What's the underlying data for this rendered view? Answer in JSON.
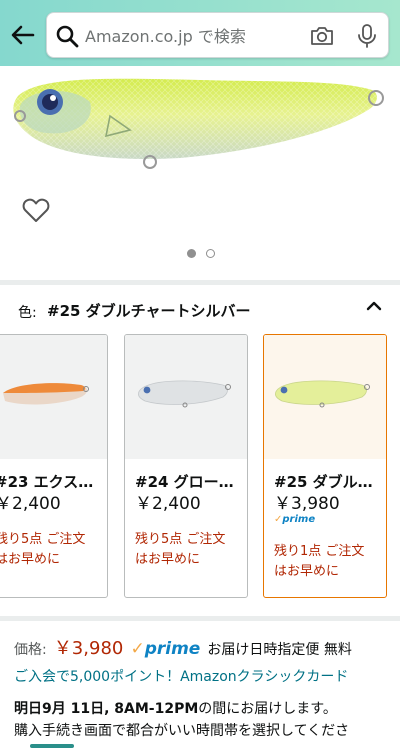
{
  "search": {
    "placeholder": "Amazon.co.jp で検索",
    "icons": [
      "back-arrow-icon",
      "search-icon",
      "camera-icon",
      "microphone-icon"
    ]
  },
  "gallery": {
    "current_image": 1,
    "total_images": 2
  },
  "color_selector": {
    "label": "色:",
    "selected": "#25 ダブルチャートシルバー",
    "options": [
      {
        "name": "#23 エクス…",
        "price": "￥2,400",
        "prime": "",
        "stock_line1": "残り5点 ご注文",
        "stock_line2": "はお早めに"
      },
      {
        "name": "#24 グロー…",
        "price": "￥2,400",
        "prime": "",
        "stock_line1": "残り5点 ご注文",
        "stock_line2": "はお早めに"
      },
      {
        "name": "#25 ダブル…",
        "price": "￥3,980",
        "prime": "prime",
        "stock_line1": "残り1点 ご注文",
        "stock_line2": "はお早めに"
      }
    ]
  },
  "purchase": {
    "price_label": "価格:",
    "price": "￥3,980",
    "prime": "prime",
    "delivery_option": "お届け日時指定便 無料",
    "points_offer": "ご入会で5,000ポイント！Amazonクラシックカード",
    "delivery_bold": "明日9月 11日, 8AM-12PM",
    "delivery_rest": "の間にお届けします。",
    "delivery_line2": "購入手続き画面で都合がいい時間帯を選択してくださ"
  },
  "colors": {
    "header_start": "#85d8ce",
    "header_end": "#a6e7ce",
    "price_red": "#b12704",
    "link_teal": "#007185",
    "prime_blue": "#0f83c4",
    "selected_border": "#e77600"
  }
}
